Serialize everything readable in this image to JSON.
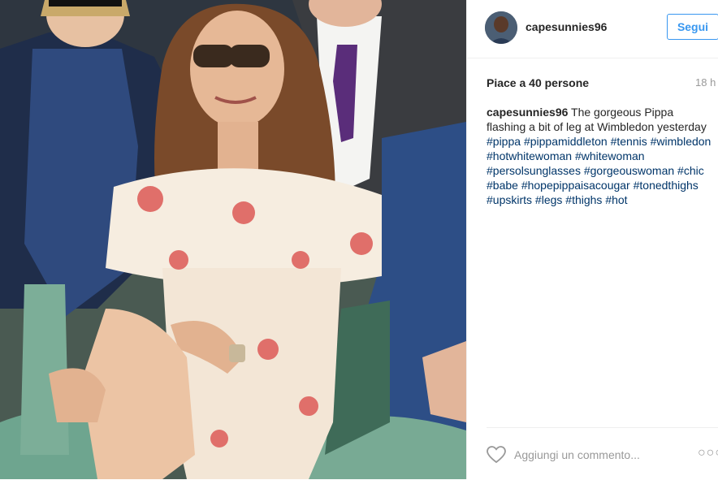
{
  "post": {
    "image_alt": "Pippa Middleton at Wimbledon",
    "user": {
      "username": "capesunnies96",
      "follow_label": "Segui"
    },
    "likes_text": "Piace a 40 persone",
    "time_ago": "18 h",
    "caption": {
      "username": "capesunnies96",
      "text": "The gorgeous Pippa flashing a bit of leg at Wimbledon yesterday",
      "hashtags": [
        "#pippa",
        "#pippamiddleton",
        "#tennis",
        "#wimbledon",
        "#hotwhitewoman",
        "#whitewoman",
        "#persolsunglasses",
        "#gorgeouswoman",
        "#chic",
        "#babe",
        "#hopepippaisacougar",
        "#tonedthighs",
        "#upskirts",
        "#legs",
        "#thighs",
        "#hot"
      ]
    },
    "comment_placeholder": "Aggiungi un commento...",
    "more_icon": "more-options-icon",
    "like_icon": "heart-icon"
  },
  "colors": {
    "link": "#003569",
    "follow": "#3897f0",
    "muted": "#999999"
  }
}
